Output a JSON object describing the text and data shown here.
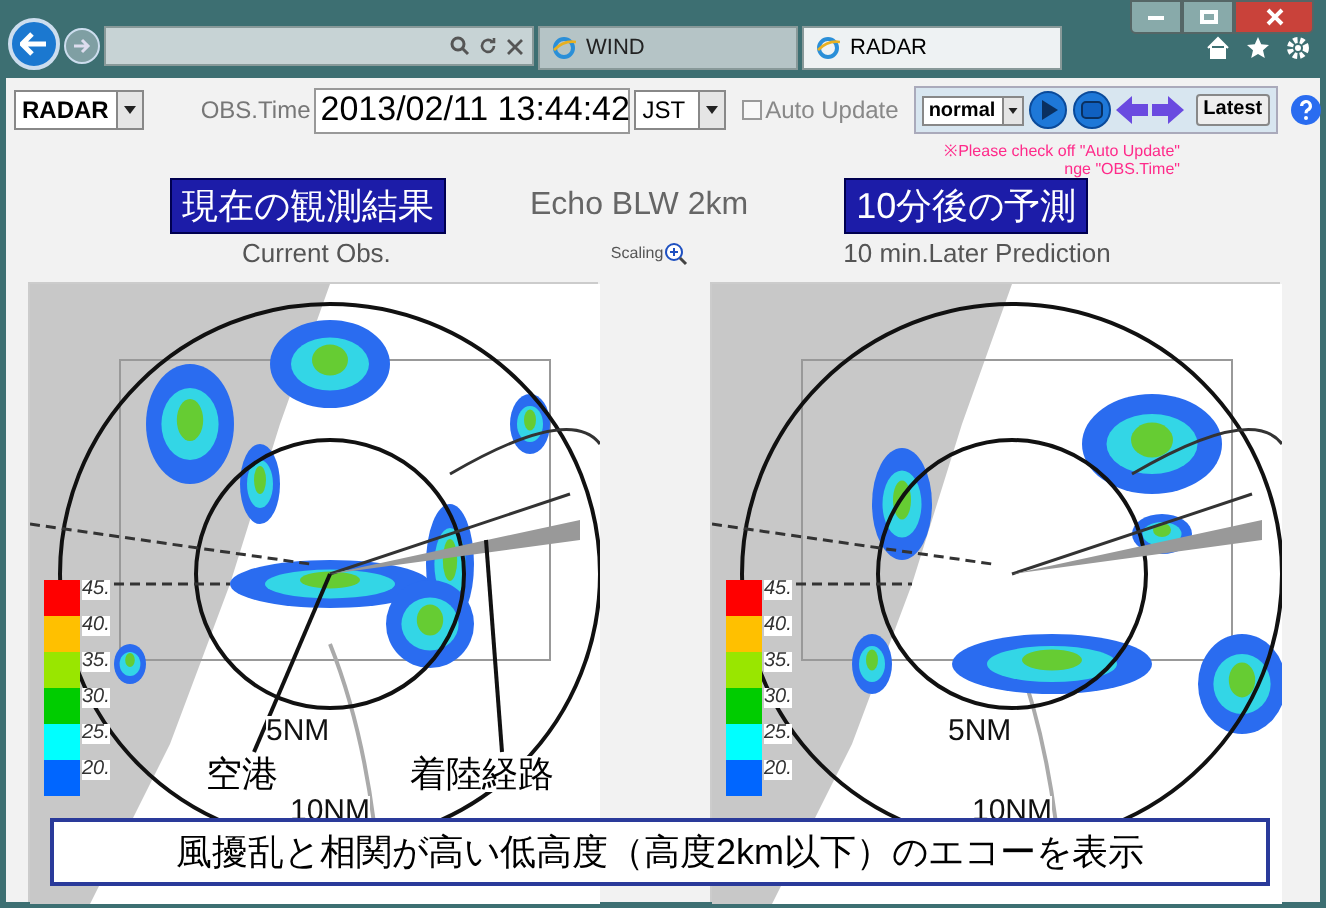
{
  "browser": {
    "tabs": [
      {
        "label": "WIND",
        "selected": false
      },
      {
        "label": "RADAR",
        "selected": true
      }
    ]
  },
  "toolbar": {
    "product": "RADAR",
    "obs_time_label": "OBS.Time",
    "obs_time": "2013/02/11 13:44:42",
    "timezone": "JST",
    "auto_update": {
      "label": "Auto Update",
      "checked": false
    },
    "speed": "normal",
    "latest": "Latest",
    "note": [
      "※Please check off \"Auto Update\"",
      "nge \"OBS.Time\""
    ]
  },
  "title": "Echo BLW 2km",
  "scaling": "Scaling",
  "panels": [
    {
      "kind": "observed",
      "banner": "現在の観測結果",
      "subtitle": "Current Obs.",
      "callouts": [
        "空港",
        "着陸経路"
      ],
      "range_labels": [
        "5NM",
        "10NM"
      ],
      "legend": [
        {
          "label": "45.",
          "color": "#ff0000"
        },
        {
          "label": "40.",
          "color": "#ffc000"
        },
        {
          "label": "35.",
          "color": "#99e600"
        },
        {
          "label": "30.",
          "color": "#00cc00"
        },
        {
          "label": "25.",
          "color": "#00ffff"
        },
        {
          "label": "20.",
          "color": "#0066ff"
        }
      ]
    },
    {
      "kind": "predicted",
      "banner": "10分後の予測",
      "subtitle": "10 min.Later Prediction",
      "range_labels": [
        "5NM",
        "10NM"
      ],
      "legend": [
        {
          "label": "45.",
          "color": "#ff0000"
        },
        {
          "label": "40.",
          "color": "#ffc000"
        },
        {
          "label": "35.",
          "color": "#99e600"
        },
        {
          "label": "30.",
          "color": "#00cc00"
        },
        {
          "label": "25.",
          "color": "#00ffff"
        },
        {
          "label": "20.",
          "color": "#0066ff"
        }
      ]
    }
  ],
  "caption": "風擾乱と相関が高い低高度（高度2km以下）のエコーを表示"
}
